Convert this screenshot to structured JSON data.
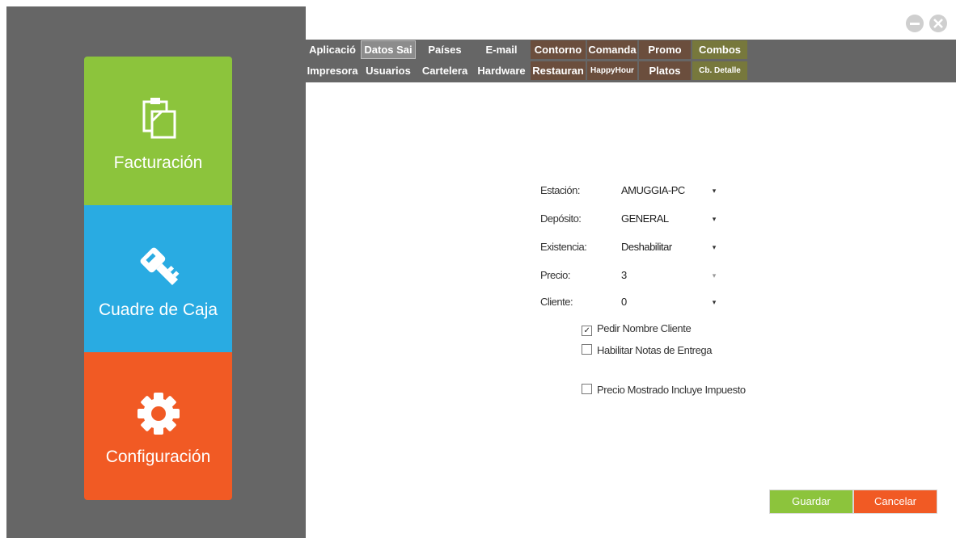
{
  "sidebar": {
    "tiles": [
      {
        "label": "Facturación",
        "icon": "clipboard-icon",
        "color": "#8cc43c"
      },
      {
        "label": "Cuadre de Caja",
        "icon": "key-icon",
        "color": "#29abe2"
      },
      {
        "label": "Configuración",
        "icon": "gear-icon",
        "color": "#f15a24"
      }
    ]
  },
  "window": {
    "minimize_icon": "minimize-icon",
    "close_icon": "close-icon"
  },
  "tabs": {
    "row1": [
      {
        "label": "Aplicació",
        "color": "#666666"
      },
      {
        "label": "Datos Sai",
        "color": "#8c8c8c",
        "selected": true
      },
      {
        "label": "Países",
        "color": "#666666"
      },
      {
        "label": "E-mail",
        "color": "#666666"
      },
      {
        "label": "Contorno",
        "color": "#6b4e3d"
      },
      {
        "label": "Comanda",
        "color": "#6b4e3d"
      },
      {
        "label": "Promo",
        "color": "#6b4e3d"
      },
      {
        "label": "Combos",
        "color": "#77783c"
      }
    ],
    "row2": [
      {
        "label": "Impresora",
        "color": "#666666"
      },
      {
        "label": "Usuarios",
        "color": "#666666"
      },
      {
        "label": "Cartelera",
        "color": "#666666"
      },
      {
        "label": "Hardware",
        "color": "#666666"
      },
      {
        "label": "Restauran",
        "color": "#6b4e3d"
      },
      {
        "label": "HappyHour",
        "color": "#6b4e3d"
      },
      {
        "label": "Platos",
        "color": "#6b4e3d"
      },
      {
        "label": "Cb. Detalle",
        "color": "#77783c"
      }
    ]
  },
  "form": {
    "estacion": {
      "label": "Estación:",
      "value": "AMUGGIA-PC"
    },
    "deposito": {
      "label": "Depósito:",
      "value": "GENERAL"
    },
    "existencia": {
      "label": "Existencia:",
      "value": "Deshabilitar"
    },
    "precio": {
      "label": "Precio:",
      "value": "3"
    },
    "cliente": {
      "label": "Cliente:",
      "value": "0"
    },
    "pedir_nombre": {
      "label": "Pedir Nombre Cliente",
      "checked": true
    },
    "notas_entrega": {
      "label": "Habilitar Notas de Entrega",
      "checked": false
    },
    "precio_impuesto": {
      "label": "Precio Mostrado Incluye Impuesto",
      "checked": false
    }
  },
  "buttons": {
    "save": "Guardar",
    "cancel": "Cancelar"
  }
}
